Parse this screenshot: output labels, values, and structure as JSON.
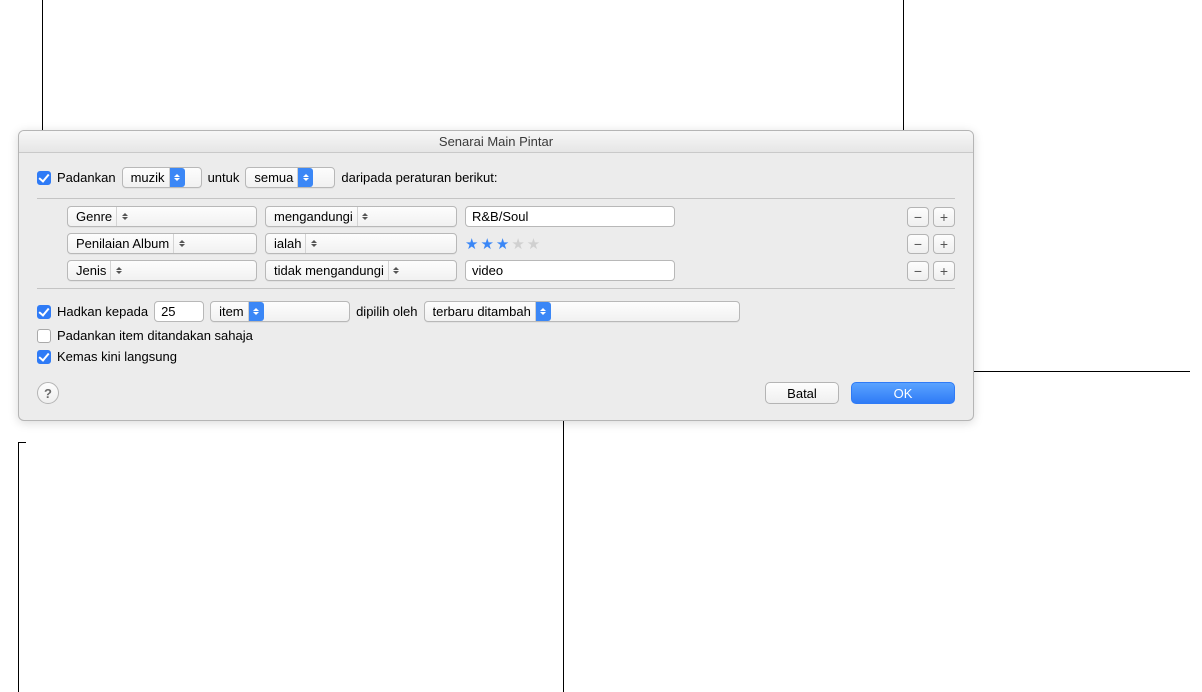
{
  "dialog": {
    "title": "Senarai Main Pintar",
    "match": {
      "checkbox_checked": true,
      "label_prefix": "Padankan",
      "media_type": "muzik",
      "label_for": "untuk",
      "scope": "semua",
      "label_suffix": "daripada peraturan berikut:"
    },
    "rules": [
      {
        "attribute": "Genre",
        "operator": "mengandungi",
        "value": "R&B/Soul",
        "value_type": "text"
      },
      {
        "attribute": "Penilaian Album",
        "operator": "ialah",
        "value": 3,
        "value_type": "stars",
        "stars_max": 5
      },
      {
        "attribute": "Jenis",
        "operator": "tidak mengandungi",
        "value": "video",
        "value_type": "text"
      }
    ],
    "pm": {
      "minus": "−",
      "plus": "+"
    },
    "limit": {
      "checked": true,
      "label": "Hadkan kepada",
      "amount": "25",
      "unit": "item",
      "selected_by_label": "dipilih oleh",
      "selected_by": "terbaru ditambah"
    },
    "match_checked_only": {
      "checked": false,
      "label": "Padankan item ditandakan sahaja"
    },
    "live_update": {
      "checked": true,
      "label": "Kemas kini langsung"
    },
    "buttons": {
      "help": "?",
      "cancel": "Batal",
      "ok": "OK"
    }
  }
}
